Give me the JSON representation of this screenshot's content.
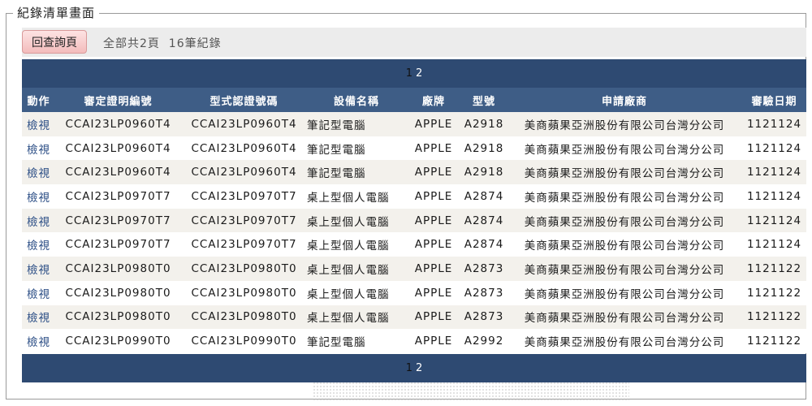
{
  "section_title": "紀錄清單畫面",
  "toolbar": {
    "back_label": "回查詢頁",
    "summary": "全部共2頁  16筆紀錄"
  },
  "pager": {
    "pages": [
      "1",
      "2"
    ],
    "current": "1"
  },
  "table": {
    "headers": [
      "動作",
      "審定證明編號",
      "型式認證號碼",
      "設備名稱",
      "廠牌",
      "型號",
      "申請廠商",
      "審驗日期"
    ],
    "rows": [
      [
        "檢視",
        "CCAI23LP0960T4",
        "CCAI23LP0960T4",
        "筆記型電腦",
        "APPLE",
        "A2918",
        "美商蘋果亞洲股份有限公司台灣分公司",
        "1121124"
      ],
      [
        "檢視",
        "CCAI23LP0960T4",
        "CCAI23LP0960T4",
        "筆記型電腦",
        "APPLE",
        "A2918",
        "美商蘋果亞洲股份有限公司台灣分公司",
        "1121124"
      ],
      [
        "檢視",
        "CCAI23LP0960T4",
        "CCAI23LP0960T4",
        "筆記型電腦",
        "APPLE",
        "A2918",
        "美商蘋果亞洲股份有限公司台灣分公司",
        "1121124"
      ],
      [
        "檢視",
        "CCAI23LP0970T7",
        "CCAI23LP0970T7",
        "桌上型個人電腦",
        "APPLE",
        "A2874",
        "美商蘋果亞洲股份有限公司台灣分公司",
        "1121124"
      ],
      [
        "檢視",
        "CCAI23LP0970T7",
        "CCAI23LP0970T7",
        "桌上型個人電腦",
        "APPLE",
        "A2874",
        "美商蘋果亞洲股份有限公司台灣分公司",
        "1121124"
      ],
      [
        "檢視",
        "CCAI23LP0970T7",
        "CCAI23LP0970T7",
        "桌上型個人電腦",
        "APPLE",
        "A2874",
        "美商蘋果亞洲股份有限公司台灣分公司",
        "1121124"
      ],
      [
        "檢視",
        "CCAI23LP0980T0",
        "CCAI23LP0980T0",
        "桌上型個人電腦",
        "APPLE",
        "A2873",
        "美商蘋果亞洲股份有限公司台灣分公司",
        "1121122"
      ],
      [
        "檢視",
        "CCAI23LP0980T0",
        "CCAI23LP0980T0",
        "桌上型個人電腦",
        "APPLE",
        "A2873",
        "美商蘋果亞洲股份有限公司台灣分公司",
        "1121122"
      ],
      [
        "檢視",
        "CCAI23LP0980T0",
        "CCAI23LP0980T0",
        "桌上型個人電腦",
        "APPLE",
        "A2873",
        "美商蘋果亞洲股份有限公司台灣分公司",
        "1121122"
      ],
      [
        "檢視",
        "CCAI23LP0990T0",
        "CCAI23LP0990T0",
        "筆記型電腦",
        "APPLE",
        "A2992",
        "美商蘋果亞洲股份有限公司台灣分公司",
        "1121122"
      ]
    ]
  },
  "colors": {
    "header_bar": "#2e4a72",
    "table_header": "#3e5d86",
    "button_pink": "#f3bcbc",
    "link_blue": "#2d4f86"
  }
}
